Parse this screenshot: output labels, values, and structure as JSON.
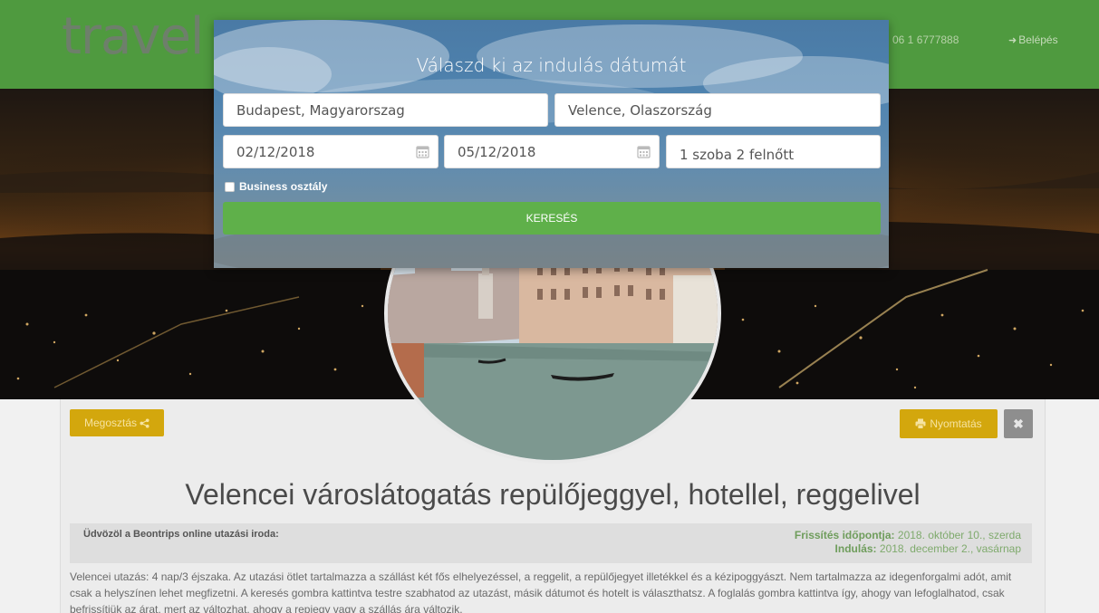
{
  "header": {
    "logo_text": "travel",
    "phone": "06 1 6777888",
    "login_label": "Belépés",
    "login_icon": "sign-in-icon"
  },
  "modal": {
    "title": "Válaszd ki az indulás dátumát",
    "from_value": "Budapest, Magyarorszag",
    "to_value": "Velence, Olaszország",
    "depart_date": "02/12/2018",
    "return_date": "05/12/2018",
    "rooms_guests": "1 szoba 2 felnőtt",
    "business_label": "Business osztály",
    "business_checked": false,
    "search_label": "KERESÉS"
  },
  "toolbar": {
    "share_label": "Megosztás",
    "share_icon": "share-icon",
    "print_label": "Nyomtatás",
    "print_icon": "print-icon",
    "close_icon": "close-icon"
  },
  "content": {
    "title": "Velencei városlátogatás repülőjeggyel, hotellel, reggelivel",
    "welcome": "Üdvözöl a Beontrips online utazási iroda:",
    "update_label": "Frissítés időpontja:",
    "update_value": "2018. október 10., szerda",
    "departure_label": "Indulás:",
    "departure_value": "2018. december 2., vasárnap",
    "description": "Velencei utazás: 4 nap/3 éjszaka. Az utazási ötlet tartalmazza a szállást két fős elhelyezéssel, a reggelit, a repülőjegyet illetékkel és a kézipoggyászt. Nem tartalmazza az idegenforgalmi adót, amit csak a helyszínen lehet megfizetni. A keresés gombra kattintva testre szabhatod az utazást, másik dátumot és hotelt is választhatsz. A foglalás gombra kattintva így, ahogy van lefoglalhatod, csak befrissítjük az árat, mert az változhat, ahogy a repjegy vagy a szállás ára változik."
  },
  "colors": {
    "header_green": "#4f9a3f",
    "button_gold": "#d3a70d",
    "search_green": "#5fb04a",
    "close_gray": "#8e8e8e"
  }
}
